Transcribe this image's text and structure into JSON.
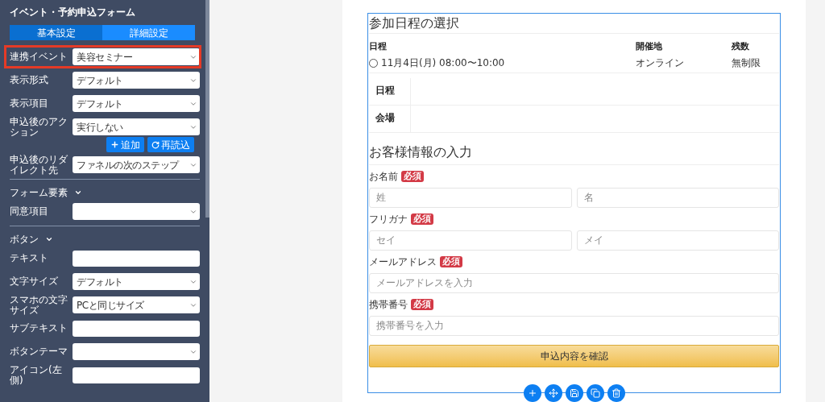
{
  "sidebar": {
    "title": "イベント・予約申込フォーム",
    "tabs": [
      {
        "label": "基本設定",
        "selected": false
      },
      {
        "label": "詳細設定",
        "selected": true
      }
    ],
    "rows": [
      {
        "kind": "select",
        "label": "連携イベント",
        "value": "美容セミナー",
        "highlighted": true
      },
      {
        "kind": "select",
        "label": "表示形式",
        "value": "デフォルト",
        "highlighted": false
      },
      {
        "kind": "select",
        "label": "表示項目",
        "value": "デフォルト",
        "highlighted": false
      },
      {
        "kind": "select",
        "label": "申込後のアクション",
        "value": "実行しない",
        "highlighted": false
      },
      {
        "kind": "actions",
        "buttons": [
          {
            "label": "追加"
          },
          {
            "label": "再読込"
          }
        ]
      },
      {
        "kind": "select",
        "label": "申込後のリダイレクト先",
        "value": "ファネルの次のステップ",
        "highlighted": false
      },
      {
        "kind": "section",
        "label": "フォーム要素"
      },
      {
        "kind": "select",
        "label": "同意項目",
        "highlighted": false
      },
      {
        "kind": "section",
        "label": "ボタン"
      },
      {
        "kind": "input",
        "label": "テキスト"
      },
      {
        "kind": "select",
        "label": "文字サイズ",
        "value": "デフォルト",
        "highlighted": false
      },
      {
        "kind": "select",
        "label": "スマホの文字サイズ",
        "value": "PCと同じサイズ",
        "highlighted": false
      },
      {
        "kind": "input",
        "label": "サブテキスト"
      },
      {
        "kind": "select",
        "label": "ボタンテーマ",
        "highlighted": false
      },
      {
        "kind": "input",
        "label": "アイコン(左側)"
      }
    ]
  },
  "form": {
    "schedule": {
      "title": "参加日程の選択",
      "columns": [
        "日程",
        "開催地",
        "残数"
      ],
      "rows": [
        {
          "date": "11月4日(月) 08:00〜10:00",
          "place": "オンライン",
          "remaining": "無制限",
          "selected": false
        }
      ],
      "details": [
        {
          "label": "日程"
        },
        {
          "label": "会場"
        }
      ]
    },
    "customer": {
      "title": "お客様情報の入力",
      "fields": [
        {
          "label": "お名前",
          "badge": "必須",
          "placeholders": [
            "姓",
            "名"
          ]
        },
        {
          "label": "フリガナ",
          "badge": "必須",
          "placeholders": [
            "セイ",
            "メイ"
          ]
        },
        {
          "label": "メールアドレス",
          "badge": "必須",
          "placeholders": [
            "メールアドレスを入力"
          ]
        },
        {
          "label": "携帯番号",
          "badge": "必須",
          "placeholders": [
            "携帯番号を入力"
          ]
        }
      ]
    },
    "submit": "申込内容を確認"
  }
}
